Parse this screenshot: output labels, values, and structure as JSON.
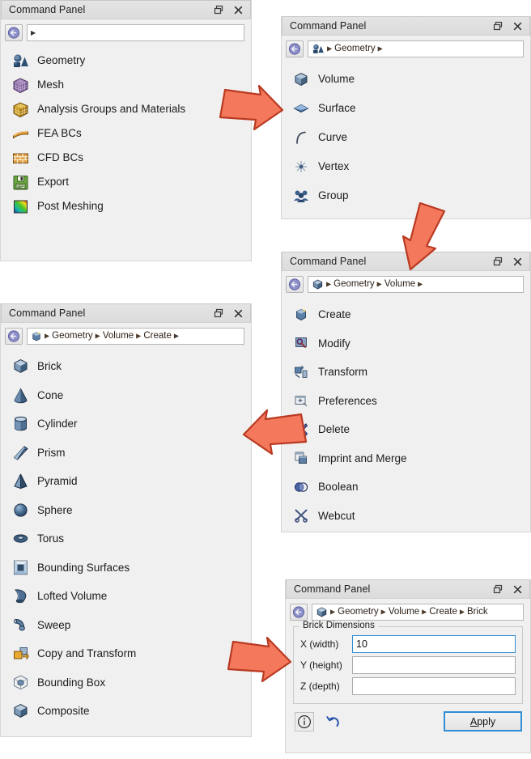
{
  "window_title": "Command Panel",
  "titlebar_icons": {
    "float": "float-restore-icon",
    "close": "close-icon"
  },
  "colors": {
    "arrow_fill": "#F4785C",
    "arrow_stroke": "#B93A22",
    "panel_bg": "#f0f0f0",
    "focus_blue": "#2f8ed6"
  },
  "panels": [
    {
      "id": "root",
      "title": "Command Panel",
      "breadcrumb": {
        "icon": "",
        "segments": [],
        "leading_caret": true,
        "trailing_caret": false
      },
      "items": [
        {
          "label": "Geometry",
          "icon": "geometry-icon"
        },
        {
          "label": "Mesh",
          "icon": "mesh-icon"
        },
        {
          "label": "Analysis Groups and Materials",
          "icon": "analysis-groups-icon"
        },
        {
          "label": "FEA BCs",
          "icon": "fea-bcs-icon"
        },
        {
          "label": "CFD BCs",
          "icon": "cfd-bcs-icon"
        },
        {
          "label": "Export",
          "icon": "export-icon"
        },
        {
          "label": "Post Meshing",
          "icon": "post-meshing-icon"
        }
      ]
    },
    {
      "id": "geometry",
      "title": "Command Panel",
      "breadcrumb": {
        "icon": "geometry-icon",
        "segments": [
          "Geometry"
        ],
        "leading_caret": true,
        "trailing_caret": true
      },
      "items": [
        {
          "label": "Volume",
          "icon": "volume-icon"
        },
        {
          "label": "Surface",
          "icon": "surface-icon"
        },
        {
          "label": "Curve",
          "icon": "curve-icon"
        },
        {
          "label": "Vertex",
          "icon": "vertex-icon"
        },
        {
          "label": "Group",
          "icon": "group-icon"
        }
      ]
    },
    {
      "id": "volume",
      "title": "Command Panel",
      "breadcrumb": {
        "icon": "volume-icon",
        "segments": [
          "Geometry",
          "Volume"
        ],
        "leading_caret": true,
        "trailing_caret": true
      },
      "items": [
        {
          "label": "Create",
          "icon": "create-icon"
        },
        {
          "label": "Modify",
          "icon": "modify-icon"
        },
        {
          "label": "Transform",
          "icon": "transform-icon"
        },
        {
          "label": "Preferences",
          "icon": "preferences-icon"
        },
        {
          "label": "Delete",
          "icon": "delete-icon"
        },
        {
          "label": "Imprint and Merge",
          "icon": "imprint-merge-icon"
        },
        {
          "label": "Boolean",
          "icon": "boolean-icon"
        },
        {
          "label": "Webcut",
          "icon": "webcut-icon"
        }
      ]
    },
    {
      "id": "create",
      "title": "Command Panel",
      "breadcrumb": {
        "icon": "create-icon",
        "segments": [
          "Geometry",
          "Volume",
          "Create"
        ],
        "leading_caret": true,
        "trailing_caret": true
      },
      "items": [
        {
          "label": "Brick",
          "icon": "brick-icon"
        },
        {
          "label": "Cone",
          "icon": "cone-icon"
        },
        {
          "label": "Cylinder",
          "icon": "cylinder-icon"
        },
        {
          "label": "Prism",
          "icon": "prism-icon"
        },
        {
          "label": "Pyramid",
          "icon": "pyramid-icon"
        },
        {
          "label": "Sphere",
          "icon": "sphere-icon"
        },
        {
          "label": "Torus",
          "icon": "torus-icon"
        },
        {
          "label": "Bounding Surfaces",
          "icon": "bounding-surfaces-icon"
        },
        {
          "label": "Lofted Volume",
          "icon": "lofted-volume-icon"
        },
        {
          "label": "Sweep",
          "icon": "sweep-icon"
        },
        {
          "label": "Copy and Transform",
          "icon": "copy-transform-icon"
        },
        {
          "label": "Bounding Box",
          "icon": "bounding-box-icon"
        },
        {
          "label": "Composite",
          "icon": "composite-icon"
        }
      ]
    },
    {
      "id": "brick",
      "title": "Command Panel",
      "breadcrumb": {
        "icon": "brick-icon",
        "segments": [
          "Geometry",
          "Volume",
          "Create",
          "Brick"
        ],
        "leading_caret": true,
        "trailing_caret": false
      },
      "form": {
        "group_label": "Brick Dimensions",
        "fields": [
          {
            "label": "X (width)",
            "value": "10",
            "focused": true
          },
          {
            "label": "Y (height)",
            "value": "",
            "focused": false
          },
          {
            "label": "Z (depth)",
            "value": "",
            "focused": false
          }
        ],
        "info_button": "info-icon",
        "reset_button": "undo-icon",
        "apply_label": "Apply",
        "apply_accel": "A"
      }
    }
  ]
}
